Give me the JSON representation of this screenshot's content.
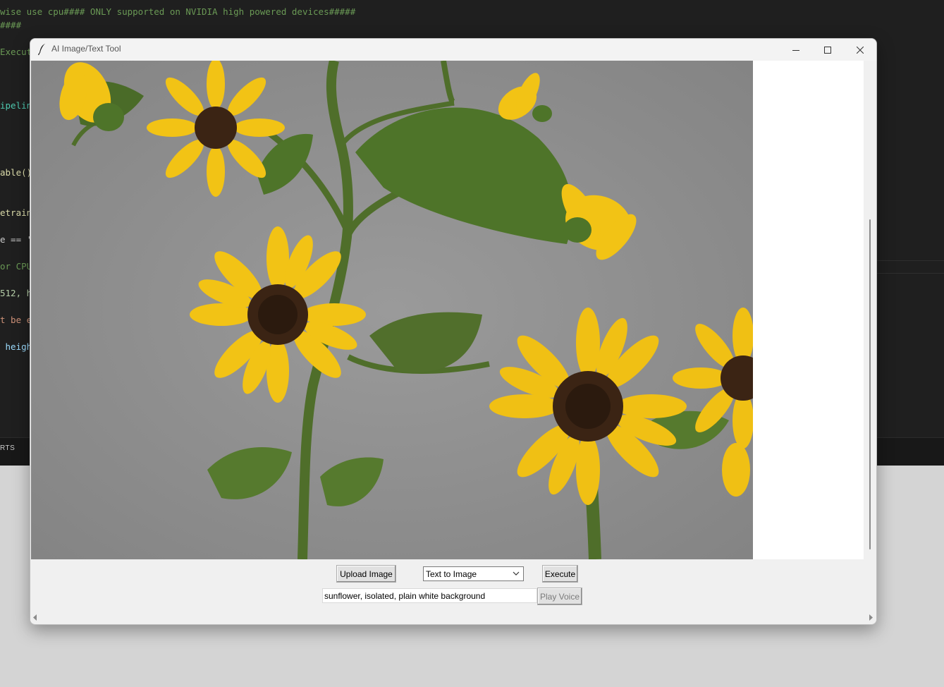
{
  "background_editor": {
    "lines": [
      {
        "text": "wise use cpu#### ONLY supported on NVIDIA high powered devices#####",
        "color": "#6a9955"
      },
      {
        "text": "####",
        "color": "#6a9955"
      },
      {
        "text": "Execut",
        "color": "#6a9955"
      },
      {
        "text": "ipelin",
        "color": "#4ec9b0"
      },
      {
        "text": "able()",
        "color": "#dcdcaa"
      },
      {
        "text": "etrain",
        "color": "#dcdcaa"
      },
      {
        "text": "e == '",
        "color": "#cccccc"
      },
      {
        "text": "or CPU",
        "color": "#6a9955"
      },
      {
        "text": "512, h",
        "color": "#b5cea8"
      },
      {
        "text": "t be e",
        "color": "#ce9178"
      },
      {
        "text": " heigh",
        "color": "#9cdcfe"
      }
    ],
    "panel_tab": "RTS"
  },
  "window": {
    "title": "AI Image/Text Tool",
    "icon": "feather-icon"
  },
  "controls": {
    "upload_label": "Upload Image",
    "mode_selected": "Text to Image",
    "execute_label": "Execute",
    "prompt_value": "sunflower, isolated, plain white background",
    "play_voice_label": "Play Voice"
  },
  "colors": {
    "image_background": "#8e8e8e",
    "petal": "#f2c315",
    "center": "#3b2414",
    "leaf": "#4e7429",
    "stem": "#4f6e2a"
  }
}
